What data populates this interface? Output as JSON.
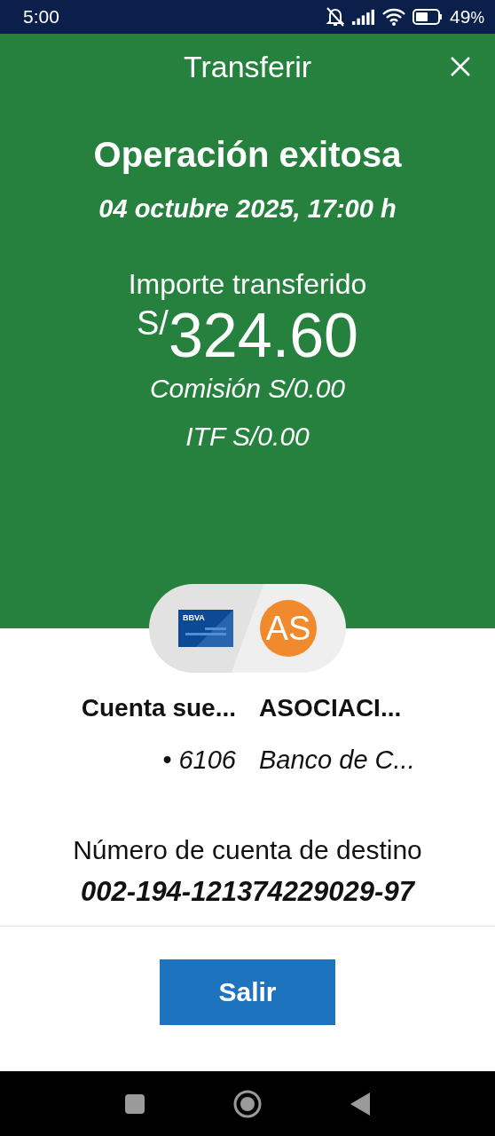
{
  "status_bar": {
    "time": "5:00",
    "battery": "49",
    "battery_unit": "%"
  },
  "header": {
    "title": "Transferir"
  },
  "result": {
    "title": "Operación exitosa",
    "date": "04 octubre 2025, 17:00 h",
    "amount_label": "Importe transferido",
    "currency": "S/",
    "amount": "324.60",
    "commission": "Comisión S/0.00",
    "itf": "ITF S/0.00"
  },
  "parties": {
    "origin": {
      "logo_text": "BBVA",
      "name": "Cuenta sue...",
      "account": "• 6106"
    },
    "destination": {
      "initials": "AS",
      "name": "ASOCIACI...",
      "bank": "Banco de C..."
    }
  },
  "destination_account": {
    "label": "Número de cuenta de destino",
    "number": "002-194-121374229029-97"
  },
  "buttons": [
    {
      "label": "Salir"
    }
  ]
}
